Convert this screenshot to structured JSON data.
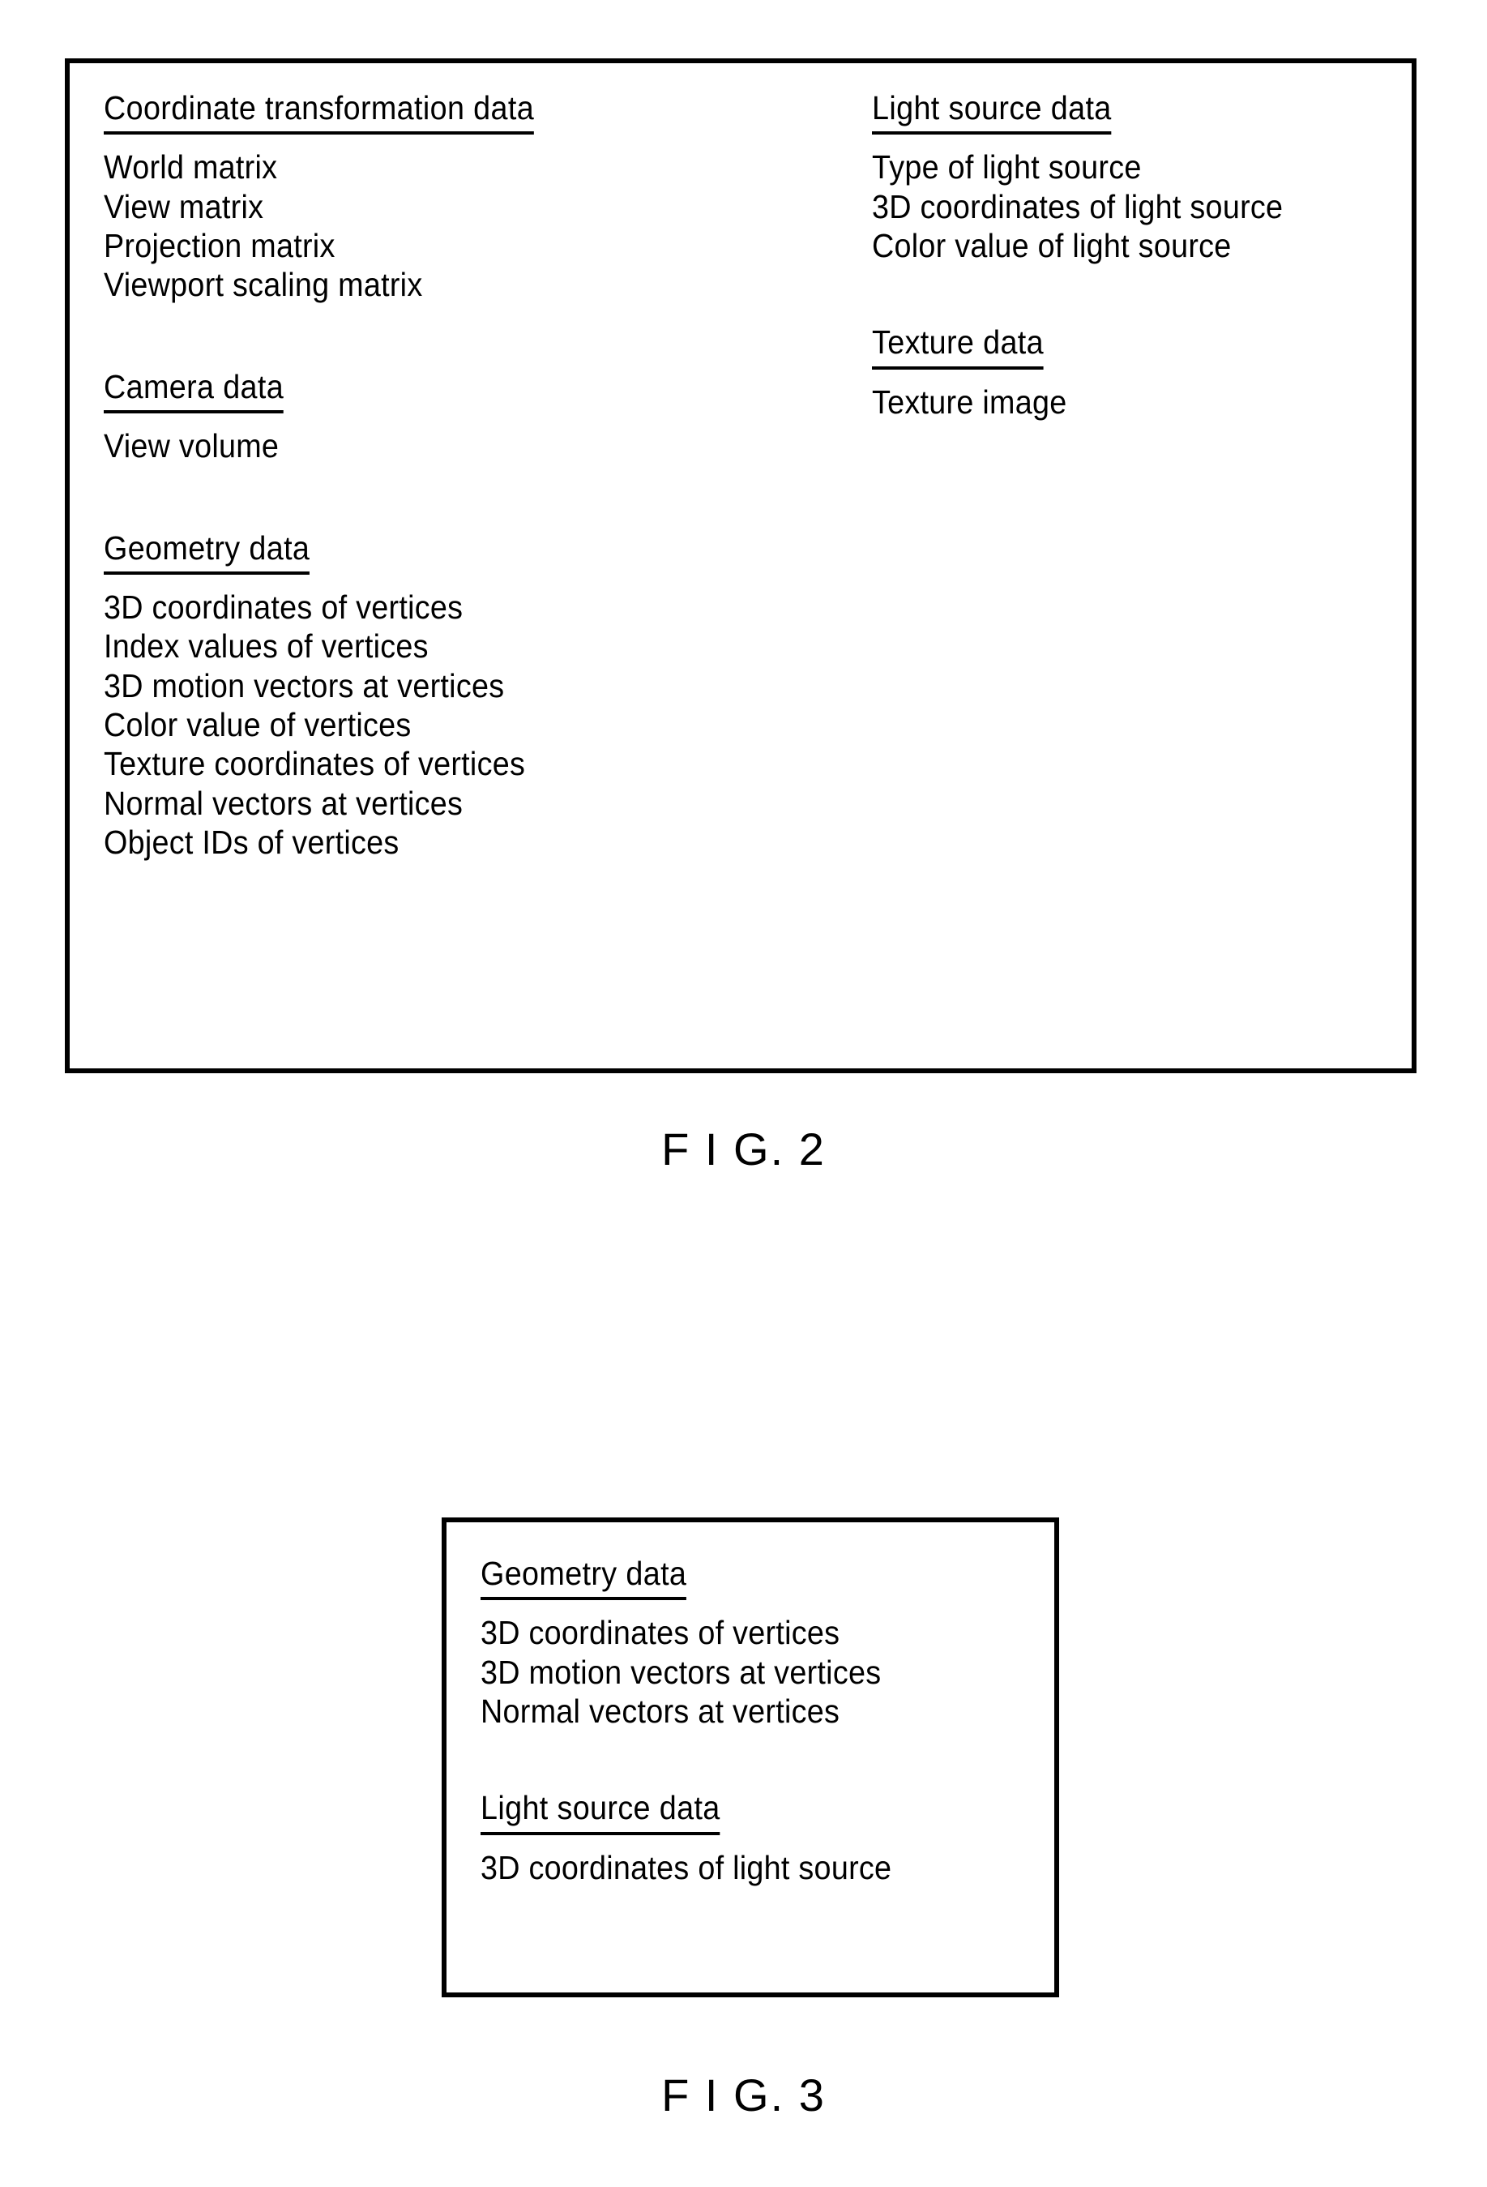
{
  "figures": [
    {
      "caption": "F I G. 2",
      "columns": {
        "left": [
          {
            "heading": "Coordinate transformation data",
            "items": [
              "World matrix",
              "View matrix",
              "Projection matrix",
              "Viewport scaling matrix"
            ]
          },
          {
            "heading": "Camera data",
            "items": [
              "View volume"
            ]
          },
          {
            "heading": "Geometry data",
            "items": [
              "3D coordinates of vertices",
              "Index values of vertices",
              "3D motion vectors at vertices",
              "Color value of vertices",
              "Texture coordinates of vertices",
              "Normal vectors at vertices",
              "Object IDs of vertices"
            ]
          }
        ],
        "right": [
          {
            "heading": "Light source data",
            "items": [
              "Type of light source",
              "3D coordinates of light source",
              "Color value of light source"
            ]
          },
          {
            "heading": "Texture data",
            "items": [
              "Texture image"
            ]
          }
        ]
      }
    },
    {
      "caption": "F I G. 3",
      "blocks": [
        {
          "heading": "Geometry data",
          "items": [
            "3D coordinates of vertices",
            "3D motion vectors at vertices",
            "Normal vectors at vertices"
          ]
        },
        {
          "heading": "Light source data",
          "items": [
            "3D coordinates of light source"
          ]
        }
      ]
    }
  ],
  "colors": {
    "ink": "#000000",
    "paper": "#ffffff"
  }
}
